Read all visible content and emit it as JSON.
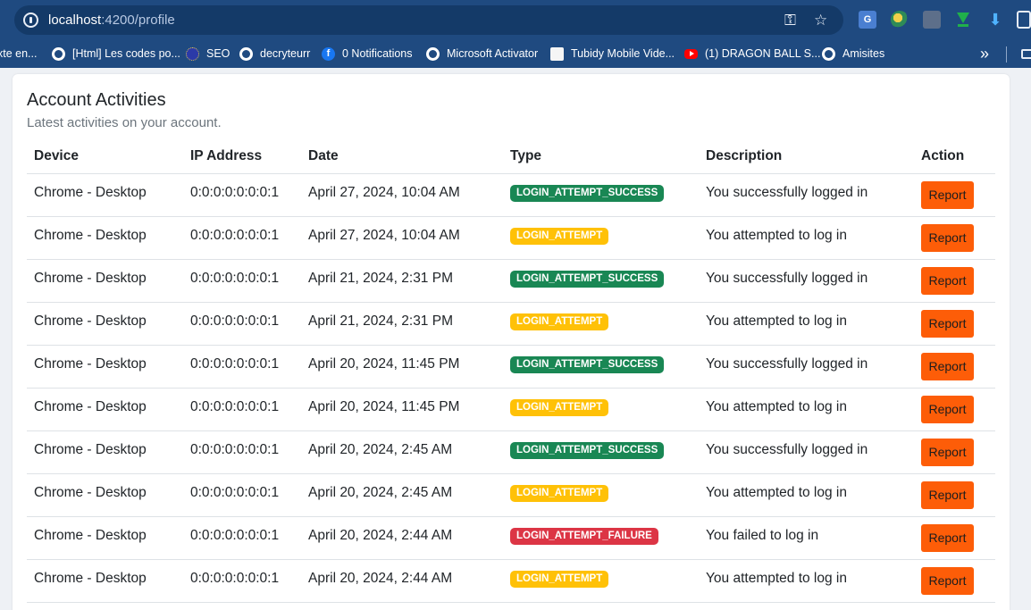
{
  "browser": {
    "url_host": "localhost",
    "url_path": ":4200/profile",
    "bookmarks": [
      {
        "label": "xte en...",
        "icon": "none"
      },
      {
        "label": "[Html] Les codes po...",
        "icon": "globe-icon"
      },
      {
        "label": "SEO",
        "icon": "eu-icon"
      },
      {
        "label": "decryteurr",
        "icon": "globe-icon"
      },
      {
        "label": "0 Notifications",
        "icon": "facebook-icon"
      },
      {
        "label": "Microsoft Activator",
        "icon": "globe-icon"
      },
      {
        "label": "Tubidy Mobile Vide...",
        "icon": "tubidy-icon"
      },
      {
        "label": "(1) DRAGON BALL S...",
        "icon": "youtube-icon"
      },
      {
        "label": "Amisites",
        "icon": "globe-icon"
      }
    ],
    "more_bookmarks": "»"
  },
  "card": {
    "title": "Account Activities",
    "subtitle": "Latest activities on your account."
  },
  "table": {
    "headers": [
      "Device",
      "IP Address",
      "Date",
      "Type",
      "Description",
      "Action"
    ],
    "rows": [
      {
        "device": "Chrome - Desktop",
        "ip": "0:0:0:0:0:0:0:1",
        "date": "April 27, 2024, 10:04 AM",
        "type": "LOGIN_ATTEMPT_SUCCESS",
        "status": "success",
        "description": "You successfully logged in",
        "action": "Report"
      },
      {
        "device": "Chrome - Desktop",
        "ip": "0:0:0:0:0:0:0:1",
        "date": "April 27, 2024, 10:04 AM",
        "type": "LOGIN_ATTEMPT",
        "status": "warning",
        "description": "You attempted to log in",
        "action": "Report"
      },
      {
        "device": "Chrome - Desktop",
        "ip": "0:0:0:0:0:0:0:1",
        "date": "April 21, 2024, 2:31 PM",
        "type": "LOGIN_ATTEMPT_SUCCESS",
        "status": "success",
        "description": "You successfully logged in",
        "action": "Report"
      },
      {
        "device": "Chrome - Desktop",
        "ip": "0:0:0:0:0:0:0:1",
        "date": "April 21, 2024, 2:31 PM",
        "type": "LOGIN_ATTEMPT",
        "status": "warning",
        "description": "You attempted to log in",
        "action": "Report"
      },
      {
        "device": "Chrome - Desktop",
        "ip": "0:0:0:0:0:0:0:1",
        "date": "April 20, 2024, 11:45 PM",
        "type": "LOGIN_ATTEMPT_SUCCESS",
        "status": "success",
        "description": "You successfully logged in",
        "action": "Report"
      },
      {
        "device": "Chrome - Desktop",
        "ip": "0:0:0:0:0:0:0:1",
        "date": "April 20, 2024, 11:45 PM",
        "type": "LOGIN_ATTEMPT",
        "status": "warning",
        "description": "You attempted to log in",
        "action": "Report"
      },
      {
        "device": "Chrome - Desktop",
        "ip": "0:0:0:0:0:0:0:1",
        "date": "April 20, 2024, 2:45 AM",
        "type": "LOGIN_ATTEMPT_SUCCESS",
        "status": "success",
        "description": "You successfully logged in",
        "action": "Report"
      },
      {
        "device": "Chrome - Desktop",
        "ip": "0:0:0:0:0:0:0:1",
        "date": "April 20, 2024, 2:45 AM",
        "type": "LOGIN_ATTEMPT",
        "status": "warning",
        "description": "You attempted to log in",
        "action": "Report"
      },
      {
        "device": "Chrome - Desktop",
        "ip": "0:0:0:0:0:0:0:1",
        "date": "April 20, 2024, 2:44 AM",
        "type": "LOGIN_ATTEMPT_FAILURE",
        "status": "danger",
        "description": "You failed to log in",
        "action": "Report"
      },
      {
        "device": "Chrome - Desktop",
        "ip": "0:0:0:0:0:0:0:1",
        "date": "April 20, 2024, 2:44 AM",
        "type": "LOGIN_ATTEMPT",
        "status": "warning",
        "description": "You attempted to log in",
        "action": "Report"
      }
    ]
  },
  "colors": {
    "success": "#198754",
    "warning": "#ffc107",
    "danger": "#dc3545",
    "report": "#fd5d08",
    "chrome": "#1f4a80"
  }
}
